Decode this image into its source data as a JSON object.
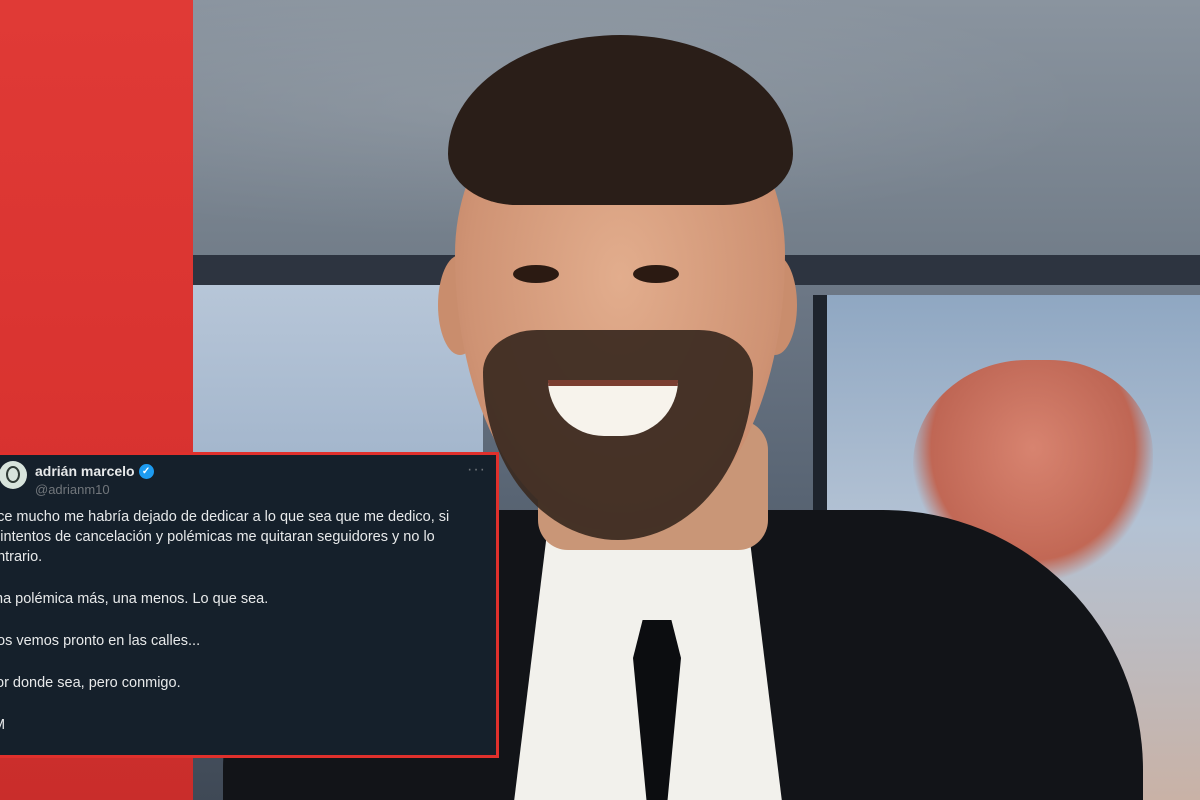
{
  "tweet": {
    "display_name": "adrián marcelo",
    "handle": "@adrianm10",
    "more_label": "···",
    "verified_icon": "verified-badge-icon",
    "paragraphs": [
      "ace mucho me habría dejado de dedicar a lo que sea que me dedico, si\ns intentos de cancelación y polémicas me quitaran seguidores y no lo\nontrario.",
      "na polémica más, una menos. Lo que sea.",
      "os vemos pronto en las calles...",
      "or donde sea, pero conmigo.",
      "M"
    ],
    "colors": {
      "background": "#15202b",
      "border": "#e0302c",
      "text": "#e7e9ea",
      "muted": "#71767b",
      "verified": "#1d9bf0"
    }
  },
  "layout_colors": {
    "red_panel": "#d8322f"
  }
}
